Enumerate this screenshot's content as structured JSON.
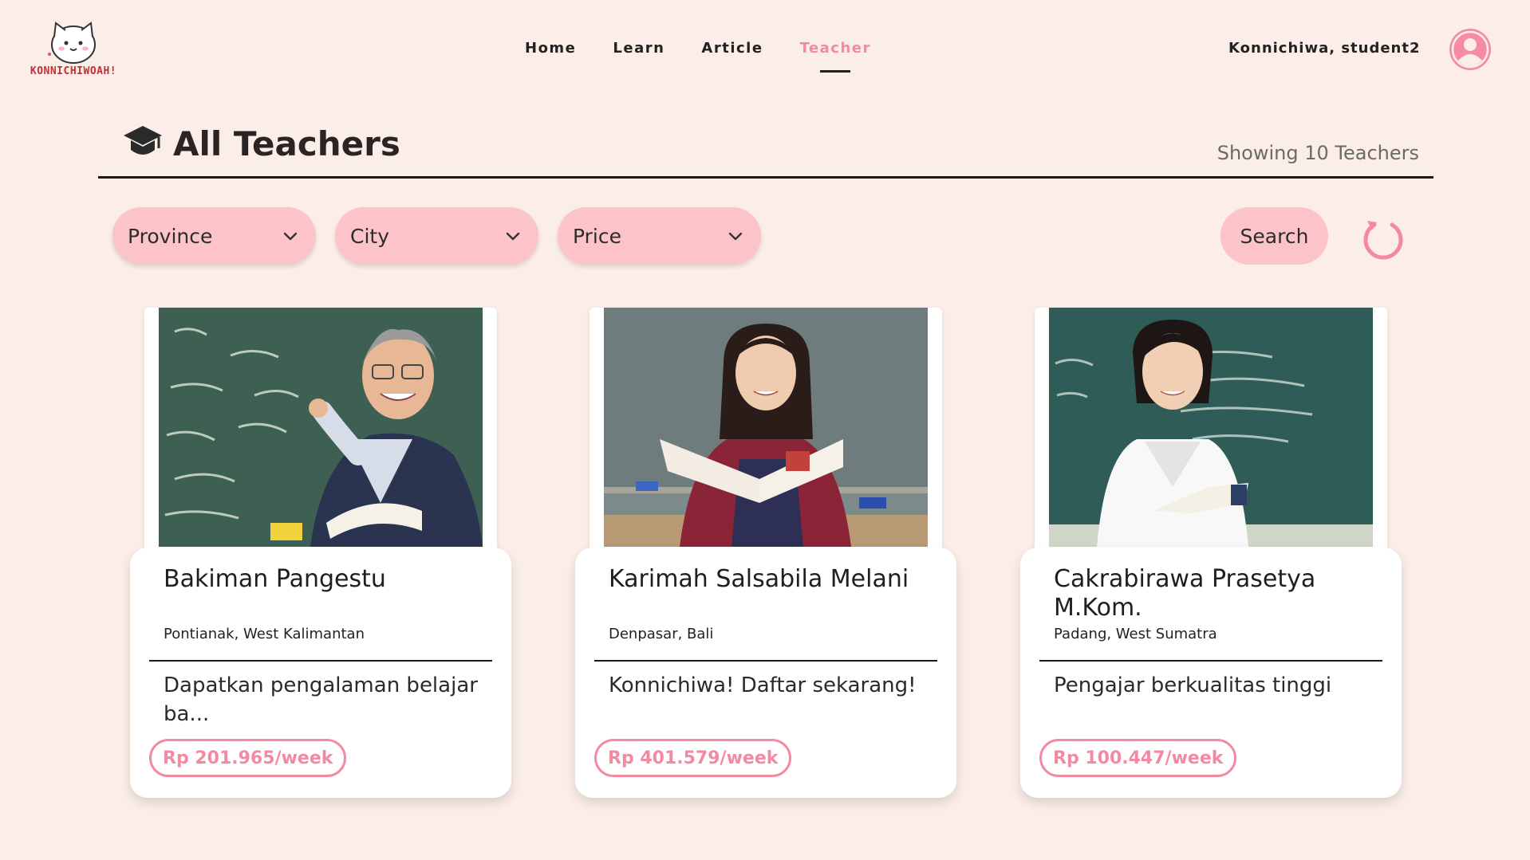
{
  "brand": {
    "name": "KONNICHIWOAH!"
  },
  "nav": {
    "items": [
      {
        "label": "Home",
        "active": false
      },
      {
        "label": "Learn",
        "active": false
      },
      {
        "label": "Article",
        "active": false
      },
      {
        "label": "Teacher",
        "active": true
      }
    ],
    "greeting": "Konnichiwa, student2"
  },
  "page": {
    "title": "All Teachers",
    "count_text": "Showing 10 Teachers"
  },
  "filters": {
    "province": "Province",
    "city": "City",
    "price": "Price",
    "search_label": "Search"
  },
  "teachers": [
    {
      "name": "Bakiman Pangestu",
      "location": "Pontianak, West Kalimantan",
      "description": "Dapatkan pengalaman belajar ba...",
      "price": "Rp 201.965/week"
    },
    {
      "name": "Karimah Salsabila Melani",
      "location": "Denpasar, Bali",
      "description": "Konnichiwa! Daftar sekarang!",
      "price": "Rp 401.579/week"
    },
    {
      "name": "Cakrabirawa Prasetya M.Kom.",
      "location": "Padang, West Sumatra",
      "description": "Pengajar berkualitas tinggi",
      "price": "Rp 100.447/week"
    }
  ],
  "colors": {
    "background": "#fbede7",
    "accent_pink": "#f48aa2",
    "filter_pink": "#fcc3c8",
    "card_white": "#ffffff",
    "text_dark": "#1f1f1f"
  },
  "icons": [
    "cat-logo-icon",
    "user-avatar-icon",
    "graduation-cap-icon",
    "chevron-down-icon",
    "reset-icon"
  ]
}
